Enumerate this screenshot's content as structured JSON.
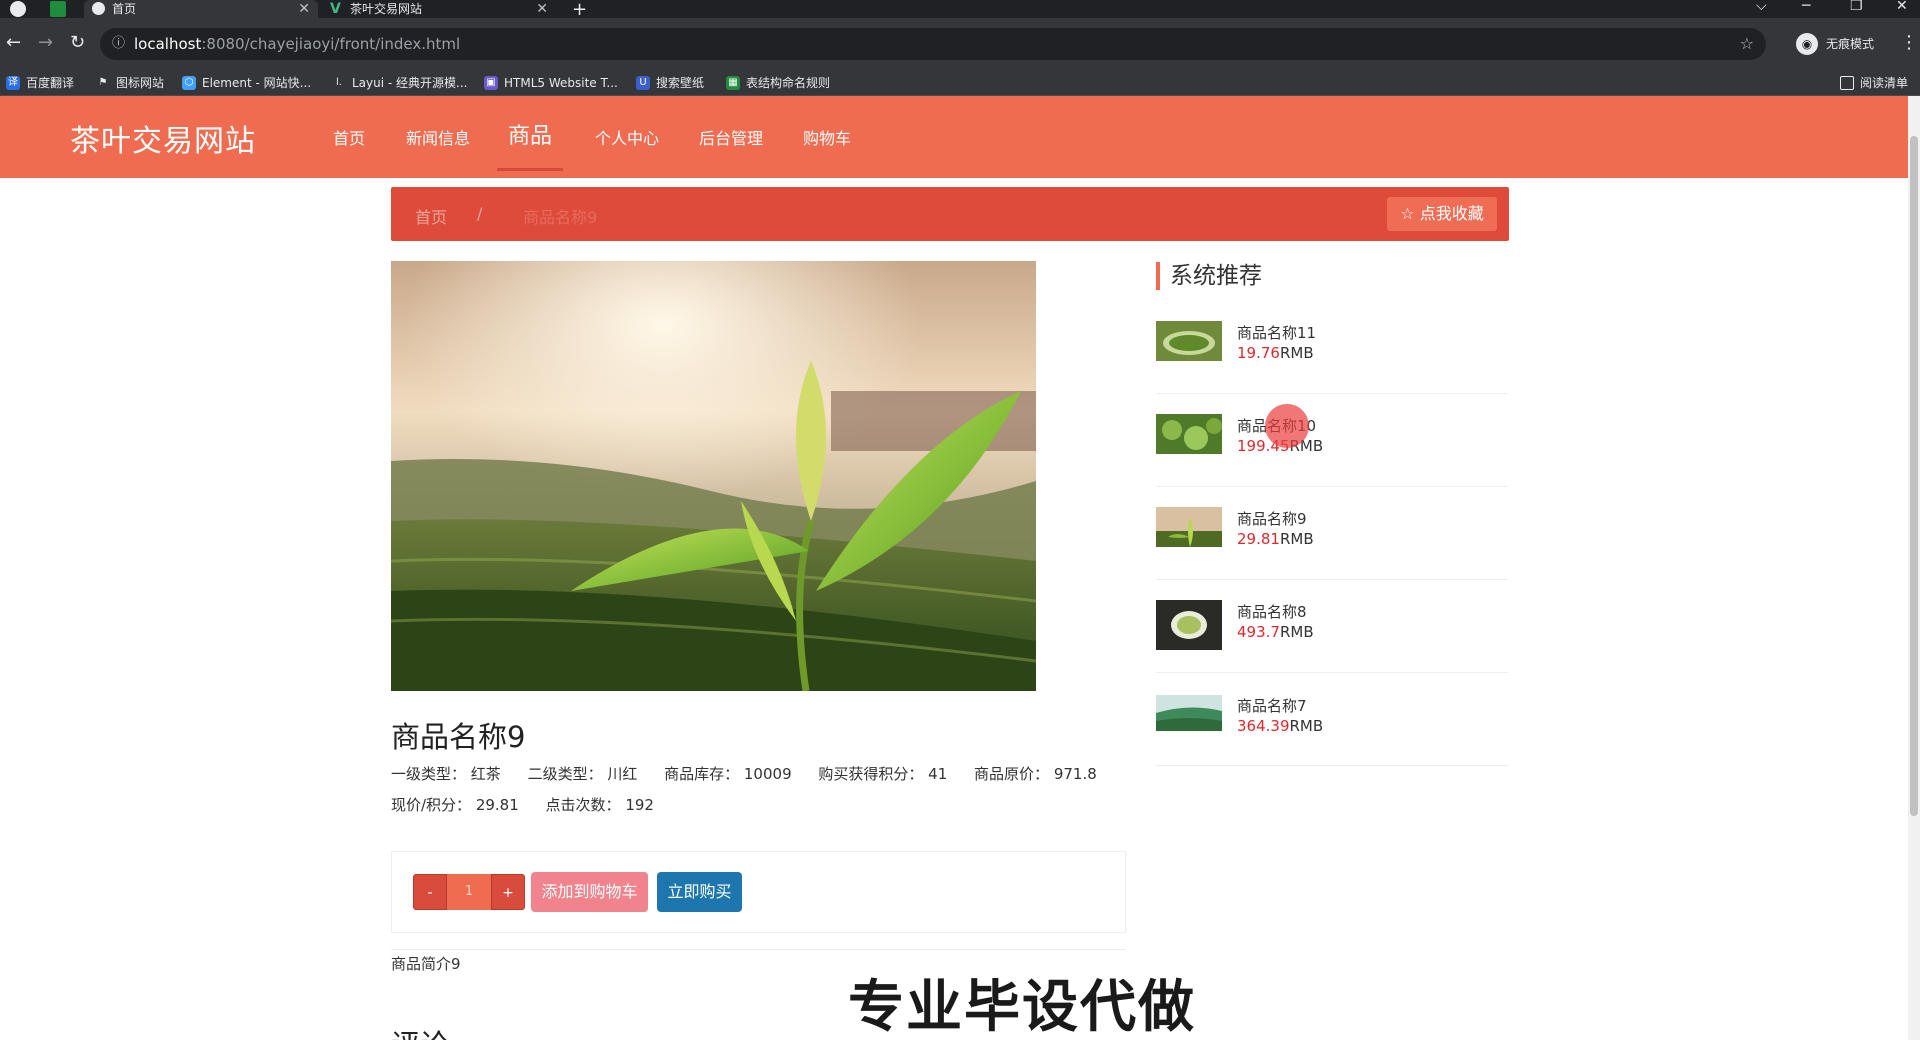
{
  "browser": {
    "tabs": [
      {
        "title": "首页"
      },
      {
        "title": "茶叶交易网站"
      }
    ],
    "new_tab": "+",
    "url_host": "localhost",
    "url_path": ":8080/chayejiaoyi/front/index.html",
    "incognito_label": "无痕模式",
    "bookmarks": [
      "百度翻译",
      "图标网站",
      "Element - 网站快...",
      "Layui - 经典开源模...",
      "HTML5 Website T...",
      "搜索壁纸",
      "表结构命名规则"
    ],
    "reading_list": "阅读清单"
  },
  "site": {
    "logo": "茶叶交易网站",
    "nav": [
      "首页",
      "新闻信息",
      "商品",
      "个人中心",
      "后台管理",
      "购物车"
    ],
    "active_nav": "商品"
  },
  "breadcrumb": {
    "home": "首页",
    "separator": "/",
    "current": "商品名称9",
    "favorite_button": "☆ 点我收藏"
  },
  "product": {
    "name": "商品名称9",
    "specs_line1": [
      "一级类型：  红茶",
      "二级类型：  川红",
      "商品库存：  10009",
      "购买获得积分：  41",
      "商品原价：  971.8"
    ],
    "specs_line2": [
      "现价/积分：  29.81",
      "点击次数：  192"
    ],
    "qty_minus": "-",
    "qty_value": "1",
    "qty_plus": "+",
    "add_to_cart": "添加到购物车",
    "buy_now": "立即购买",
    "intro": "商品简介9",
    "review_heading": "评论"
  },
  "sidebar": {
    "heading": "系统推荐",
    "currency": "RMB",
    "items": [
      {
        "name": "商品名称11",
        "price": "19.76"
      },
      {
        "name": "商品名称10",
        "price": "199.45"
      },
      {
        "name": "商品名称9",
        "price": "29.81"
      },
      {
        "name": "商品名称8",
        "price": "493.7"
      },
      {
        "name": "商品名称7",
        "price": "364.39"
      }
    ]
  },
  "overlay": {
    "watermark": "专业毕设代做"
  },
  "colors": {
    "header": "#ef6c50",
    "breadcrumb_bar": "#de4b3b",
    "price": "#e0282b",
    "buy_button": "#1d76ae",
    "cart_button": "#f0838c"
  }
}
